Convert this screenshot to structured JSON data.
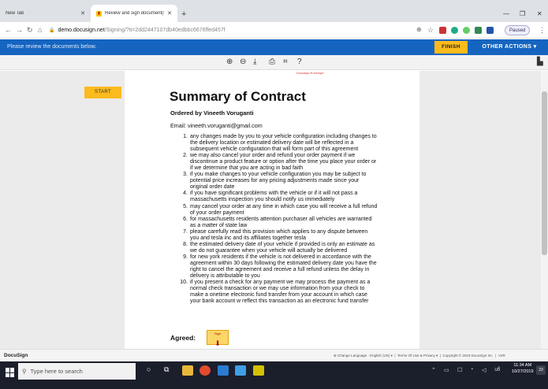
{
  "browser": {
    "tabs": [
      {
        "label": "New Tab"
      },
      {
        "label": "Review and sign document(s) | D"
      }
    ],
    "url_host": "demo.docusign.net",
    "url_path": "/Signing/?ti=2dd2447107db40edbbc6676ffed457f",
    "profile_status": "Paused"
  },
  "docusign_bar": {
    "message": "Please review the documents below.",
    "finish_label": "FINISH",
    "other_actions_label": "OTHER ACTIONS ▾"
  },
  "document": {
    "start_label": "START",
    "page_header": "Docusign Envelope",
    "title": "Summary of Contract",
    "ordered_by": "Ordered by Vineeth Voruganti",
    "email_line": "Email: vineeth.voruganti@gmail.com",
    "terms": [
      {
        "num": "1.",
        "lines": [
          "any changes made by you to your vehicle configuration including changes to",
          "the delivery location or estimated delivery date will be reflected in a",
          "subsequent vehicle configuration that will form part of this agreement"
        ]
      },
      {
        "num": "2.",
        "lines": [
          "we may also cancel your order and refund your order payment if we",
          "discontinue a product feature or option after the time you place your order or",
          "if we determine that you are acting in bad faith"
        ]
      },
      {
        "num": "3.",
        "lines": [
          "if you make changes to your vehicle configuration you may be subject to",
          "potential price increases for any pricing adjustments made since your",
          "original order date"
        ]
      },
      {
        "num": "4.",
        "lines": [
          "if you have significant problems with the vehicle or if it will not pass a",
          "massachusetts inspection you should notify us immediately"
        ]
      },
      {
        "num": "5.",
        "lines": [
          "may cancel your order at any time in which case you will receive a full refund",
          "of your order payment"
        ]
      },
      {
        "num": "6.",
        "lines": [
          "for massachusetts residents attention purchaser all vehicles are warranted",
          "as a matter of state law"
        ]
      },
      {
        "num": "7.",
        "lines": [
          "please carefully read this provision which applies to any dispute between",
          "you and tesla inc and its affiliates together tesla"
        ]
      },
      {
        "num": "8.",
        "lines": [
          "the estimated delivery date of your vehicle if provided is only an estimate as",
          "we do not guarantee when your vehicle will actually be delivered"
        ]
      },
      {
        "num": "9.",
        "lines": [
          "for new york residents if the vehicle is not delivered in accordance with the",
          "agreement within 30 days following the estimated delivery date you have the",
          "right to cancel the agreement and receive a full refund unless the delay in",
          "delivery is attributable to you"
        ]
      },
      {
        "num": "10.",
        "lines": [
          "if you present a check for any payment we may process the payment as a",
          "normal check transaction or we may use information from your check to",
          "make a onetime electronic fund transfer from your account in which case",
          "your bank account w reflect this transaction as an electronic fund transfer"
        ]
      }
    ],
    "agreed_label": "Agreed:",
    "sign_label": "Sign"
  },
  "footer": {
    "brand": "DocuSign",
    "language": "Change Language - English (US) ▾",
    "terms": "Terms Of Use & Privacy ▾",
    "copyright": "Copyright © 2019 DocuSign Inc.",
    "version": "V2R"
  },
  "taskbar": {
    "search_placeholder": "Type here to search",
    "time": "11:34 AM",
    "date": "10/27/2019",
    "notification_count": "23"
  },
  "colors": {
    "docusign_blue": "#1565c0",
    "docusign_yellow": "#fbbb1d",
    "taskbar": "#1b1f2c"
  }
}
